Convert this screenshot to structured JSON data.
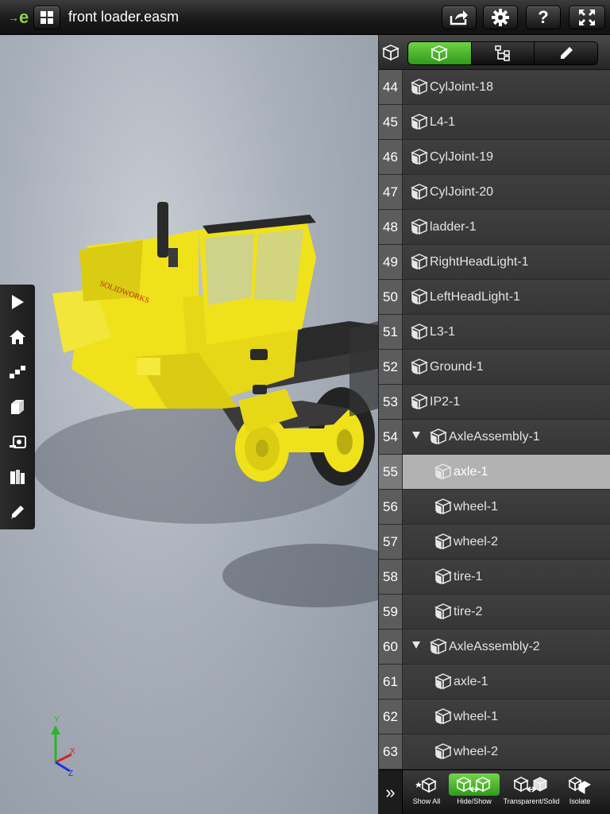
{
  "app": {
    "title": "front loader.easm",
    "top_buttons": [
      "share-icon",
      "gear-icon",
      "help-icon",
      "fullscreen-icon"
    ]
  },
  "viewport": {
    "model_brand": "SOLIDWORKS",
    "triad": {
      "x": "X",
      "y": "Y",
      "z": "Z"
    }
  },
  "left_toolbar": [
    "play-icon",
    "home-icon",
    "steps-icon",
    "views-icon",
    "section-icon",
    "explode-icon",
    "markup-icon"
  ],
  "panel": {
    "tabs": [
      {
        "name": "components-tab",
        "active": true
      },
      {
        "name": "tree-tab",
        "active": false
      },
      {
        "name": "markup-tab",
        "active": false
      }
    ],
    "rows": [
      {
        "num": "44",
        "label": "CylJoint-18",
        "level": 0
      },
      {
        "num": "45",
        "label": "L4-1",
        "level": 0
      },
      {
        "num": "46",
        "label": "CylJoint-19",
        "level": 0
      },
      {
        "num": "47",
        "label": "CylJoint-20",
        "level": 0
      },
      {
        "num": "48",
        "label": "ladder-1",
        "level": 0
      },
      {
        "num": "49",
        "label": "RightHeadLight-1",
        "level": 0
      },
      {
        "num": "50",
        "label": "LeftHeadLight-1",
        "level": 0
      },
      {
        "num": "51",
        "label": "L3-1",
        "level": 0
      },
      {
        "num": "52",
        "label": "Ground-1",
        "level": 0
      },
      {
        "num": "53",
        "label": "IP2-1",
        "level": 0
      },
      {
        "num": "54",
        "label": "AxleAssembly-1",
        "level": 0,
        "expanded": true
      },
      {
        "num": "55",
        "label": "axle-1",
        "level": 1,
        "selected": true
      },
      {
        "num": "56",
        "label": "wheel-1",
        "level": 1
      },
      {
        "num": "57",
        "label": "wheel-2",
        "level": 1
      },
      {
        "num": "58",
        "label": "tire-1",
        "level": 1
      },
      {
        "num": "59",
        "label": "tire-2",
        "level": 1
      },
      {
        "num": "60",
        "label": "AxleAssembly-2",
        "level": 0,
        "expanded": true
      },
      {
        "num": "61",
        "label": "axle-1",
        "level": 1
      },
      {
        "num": "62",
        "label": "wheel-1",
        "level": 1
      },
      {
        "num": "63",
        "label": "wheel-2",
        "level": 1
      }
    ],
    "bottom": {
      "collapse": "»",
      "show_all": "Show All",
      "hide_show": "Hide/Show",
      "transparent_solid": "Transparent/Solid",
      "isolate": "Isolate"
    }
  },
  "colors": {
    "accent_green": "#4cbb2a",
    "model_yellow": "#f0e21a",
    "selected_row": "#b2b2b2"
  }
}
